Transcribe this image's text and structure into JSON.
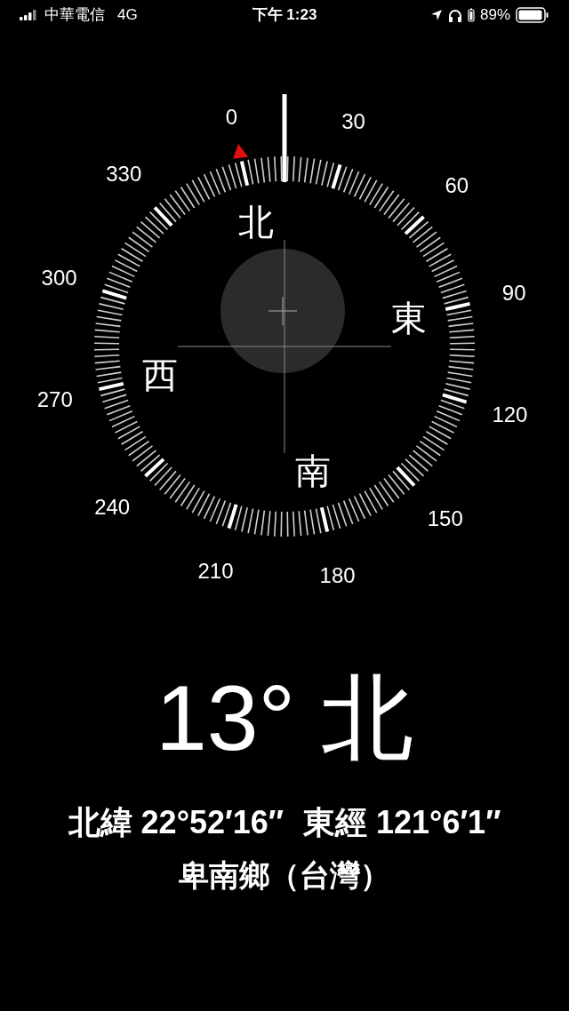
{
  "status_bar": {
    "carrier": "中華電信",
    "network": "4G",
    "time": "下午 1:23",
    "battery": "89%"
  },
  "dial": {
    "degree_labels": [
      "0",
      "30",
      "60",
      "90",
      "120",
      "150",
      "180",
      "210",
      "240",
      "270",
      "300",
      "330"
    ],
    "cardinal_labels": [
      "北",
      "東",
      "南",
      "西"
    ]
  },
  "heading": "13° 北",
  "latitude": "北緯 22°52′16″",
  "longitude": "東經 121°6′1″",
  "location": "卑南鄉（台灣）"
}
